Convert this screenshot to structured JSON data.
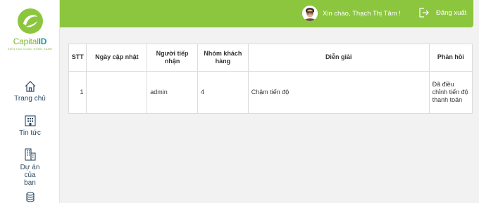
{
  "brand": {
    "name_part1": "Capital",
    "name_part2": "ID",
    "tagline": "KIẾN TẠO CUỘC SỐNG XANH",
    "color_green": "#8cc63e",
    "color_teal": "#1a9b9b"
  },
  "sidebar": {
    "items": [
      {
        "label": "Trang chủ",
        "icon": "home-icon"
      },
      {
        "label": "Tin tức",
        "icon": "news-building-icon"
      },
      {
        "label": "Dự án của bạn",
        "icon": "project-building-icon"
      },
      {
        "label": "",
        "icon": "coins-icon"
      }
    ]
  },
  "header": {
    "greeting": "Xin chào, Thạch Thị Tâm !",
    "logout_label": "Đăng xuất"
  },
  "table": {
    "columns": [
      "STT",
      "Ngày cập nhật",
      "Người tiếp nhận",
      "Nhóm khách hàng",
      "Diễn giải",
      "Phản hồi"
    ],
    "rows": [
      [
        "1",
        "",
        "admin",
        "4",
        "Chậm tiến độ",
        "Đã điều chỉnh tiến độ thanh toán"
      ]
    ]
  }
}
